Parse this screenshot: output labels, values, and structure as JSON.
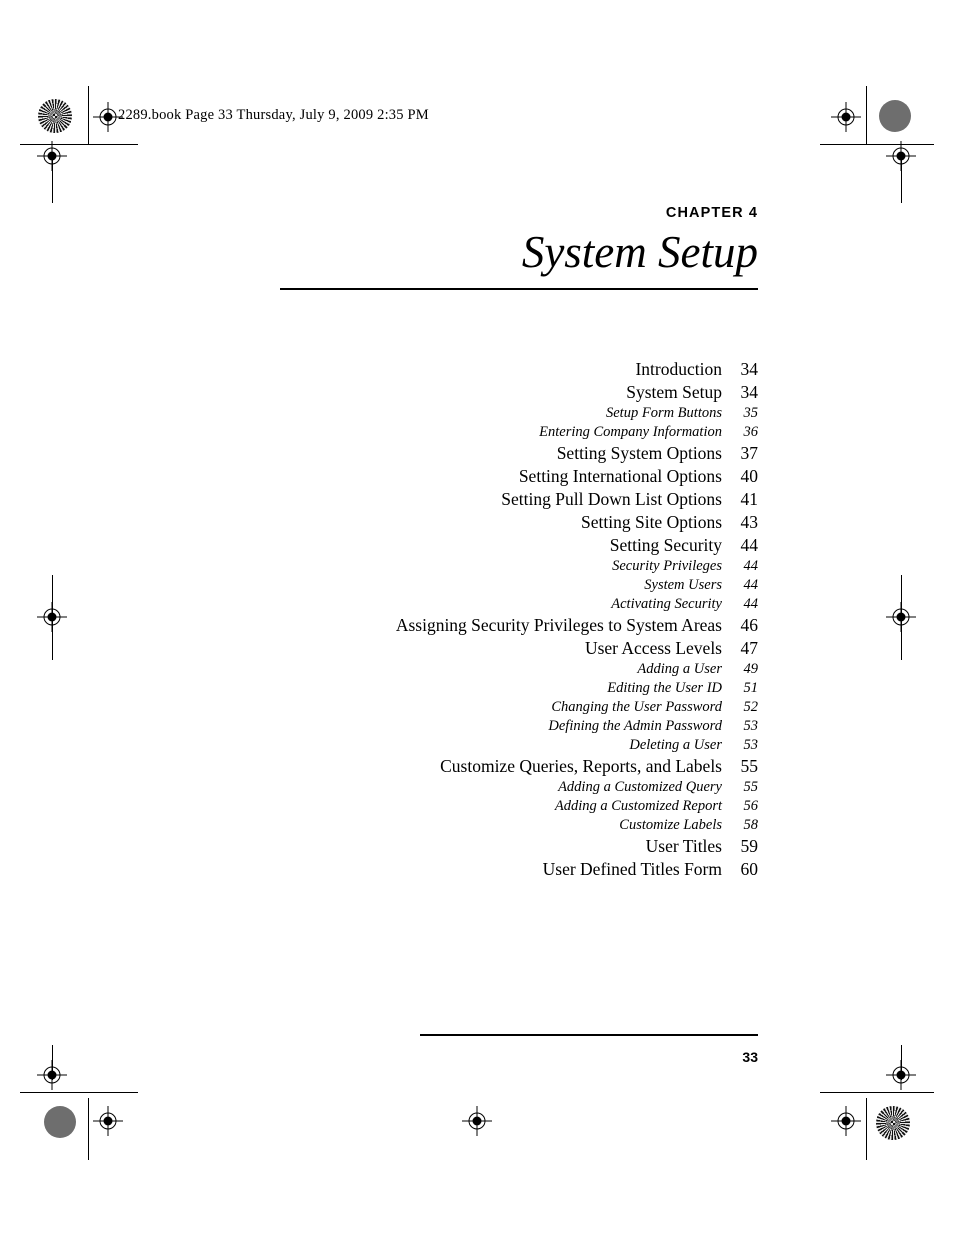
{
  "header": {
    "book_line": "2289.book  Page 33  Thursday, July 9, 2009  2:35 PM"
  },
  "chapter": {
    "label": "CHAPTER 4",
    "title": "System Setup"
  },
  "toc": {
    "entries": [
      {
        "label": "Introduction",
        "page": "34",
        "level": 1
      },
      {
        "label": "System Setup",
        "page": "34",
        "level": 1
      },
      {
        "label": "Setup Form Buttons",
        "page": "35",
        "level": 2
      },
      {
        "label": "Entering Company Information",
        "page": "36",
        "level": 2
      },
      {
        "label": "Setting System Options",
        "page": "37",
        "level": 1
      },
      {
        "label": "Setting International Options",
        "page": "40",
        "level": 1
      },
      {
        "label": "Setting Pull Down List Options",
        "page": "41",
        "level": 1
      },
      {
        "label": "Setting Site Options",
        "page": "43",
        "level": 1
      },
      {
        "label": "Setting Security",
        "page": "44",
        "level": 1
      },
      {
        "label": "Security Privileges",
        "page": "44",
        "level": 2
      },
      {
        "label": "System Users",
        "page": "44",
        "level": 2
      },
      {
        "label": "Activating Security",
        "page": "44",
        "level": 2
      },
      {
        "label": "Assigning Security Privileges to System Areas",
        "page": "46",
        "level": 1
      },
      {
        "label": "User Access Levels",
        "page": "47",
        "level": 1
      },
      {
        "label": "Adding a User",
        "page": "49",
        "level": 2
      },
      {
        "label": "Editing the User ID",
        "page": "51",
        "level": 2
      },
      {
        "label": "Changing the User Password",
        "page": "52",
        "level": 2
      },
      {
        "label": "Defining the Admin Password",
        "page": "53",
        "level": 2
      },
      {
        "label": "Deleting a User",
        "page": "53",
        "level": 2
      },
      {
        "label": "Customize Queries, Reports, and Labels",
        "page": "55",
        "level": 1
      },
      {
        "label": "Adding a Customized Query",
        "page": "55",
        "level": 2
      },
      {
        "label": "Adding a Customized Report",
        "page": "56",
        "level": 2
      },
      {
        "label": "Customize Labels",
        "page": "58",
        "level": 2
      },
      {
        "label": "User Titles",
        "page": "59",
        "level": 1
      },
      {
        "label": "User Defined Titles Form",
        "page": "60",
        "level": 1
      }
    ]
  },
  "footer": {
    "folio": "33"
  },
  "print_marks": {
    "registration_icon": "registration-target-icon",
    "halftone_icon": "halftone-star-target-icon",
    "density_icon": "gray-density-patch-icon"
  }
}
